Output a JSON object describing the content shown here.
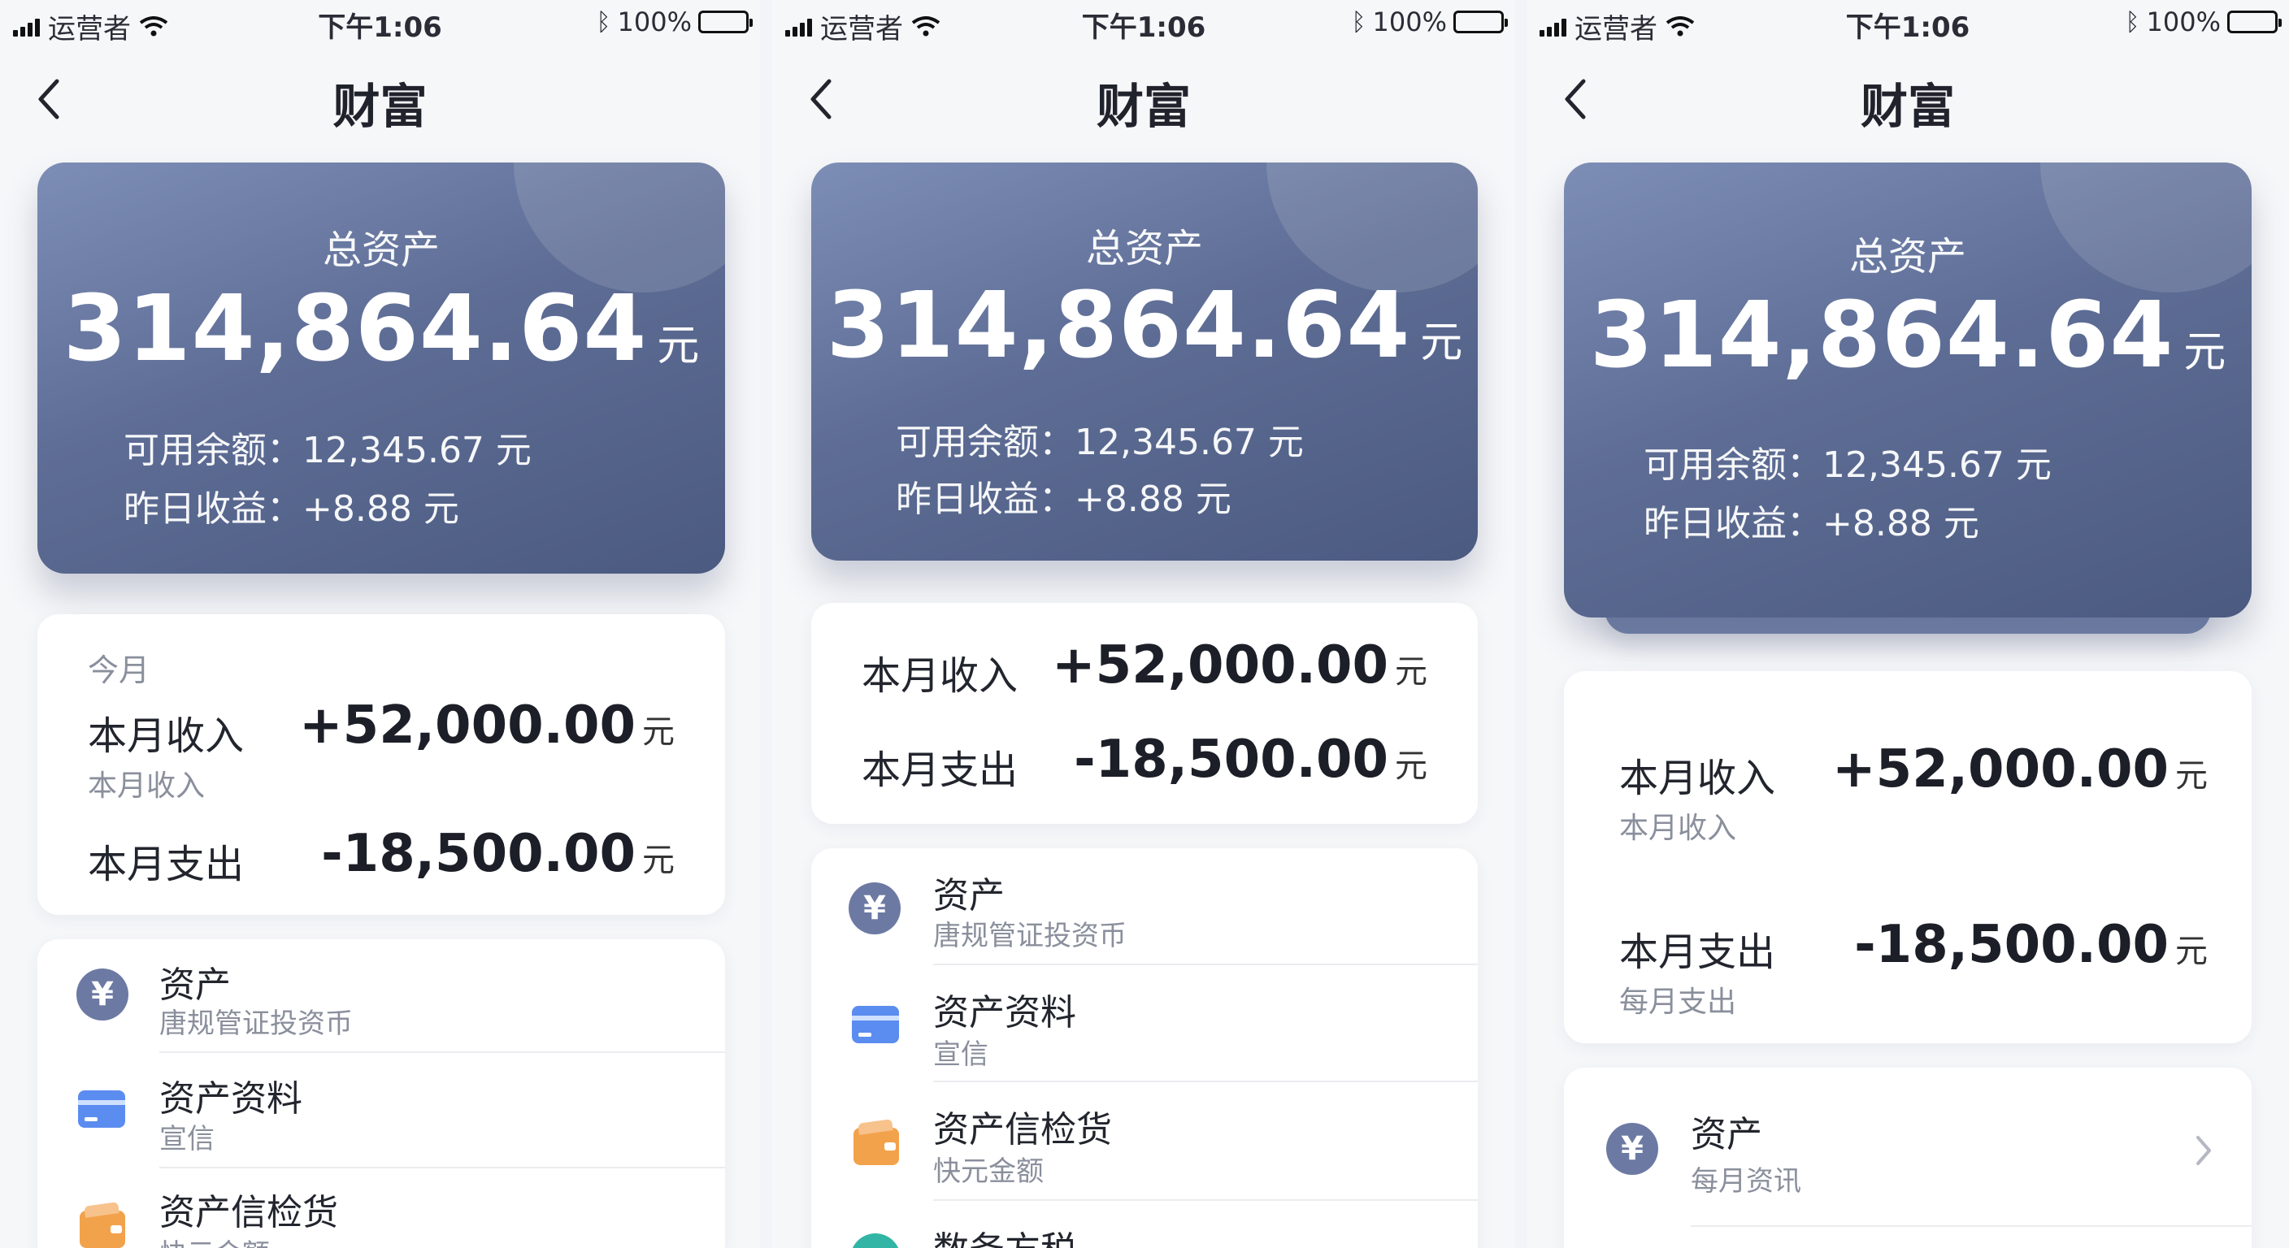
{
  "status_bar": {
    "carrier": "运营者",
    "time": "下午1:06",
    "battery": "100%",
    "icons": [
      "signal-icon",
      "wifi-icon",
      "bluetooth-icon",
      "battery-icon"
    ]
  },
  "nav": {
    "title": "财富",
    "back_icon": "chevron-left-icon"
  },
  "asset_card": {
    "label": "总资产",
    "amount": "314,864.64",
    "unit": "元",
    "balance": "可用余额：12,345.67 元",
    "yesterday": "昨日收益：+8.88 元"
  },
  "month": {
    "caption": "今月",
    "income_label": "本月收入",
    "income_sub": "本月收入",
    "income_value": "+52,000.00",
    "expense_label": "本月支出",
    "expense_sub": "每月支出",
    "expense_value": "-18,500.00",
    "unit": "元"
  },
  "list": {
    "items": [
      {
        "title": "资产",
        "sub": "唐规管证投资币",
        "icon": "yen-icon"
      },
      {
        "title": "资产资料",
        "sub": "宣信",
        "icon": "card-icon"
      },
      {
        "title": "资产信检货",
        "sub": "快元金额",
        "icon": "wallet-icon"
      },
      {
        "title": "数务方税",
        "icon": "teal-circle-icon"
      }
    ],
    "p3_item": {
      "title": "资产",
      "sub": "每月资讯",
      "icon": "yen-icon"
    }
  },
  "colors": {
    "card_gradient_top": "#7d8eb6",
    "card_gradient_bottom": "#4b5a80",
    "yen_icon": "#6c7aa3",
    "card_icon": "#5b8cf0",
    "wallet_icon": "#f3a24c",
    "teal_icon": "#33b5a6"
  }
}
